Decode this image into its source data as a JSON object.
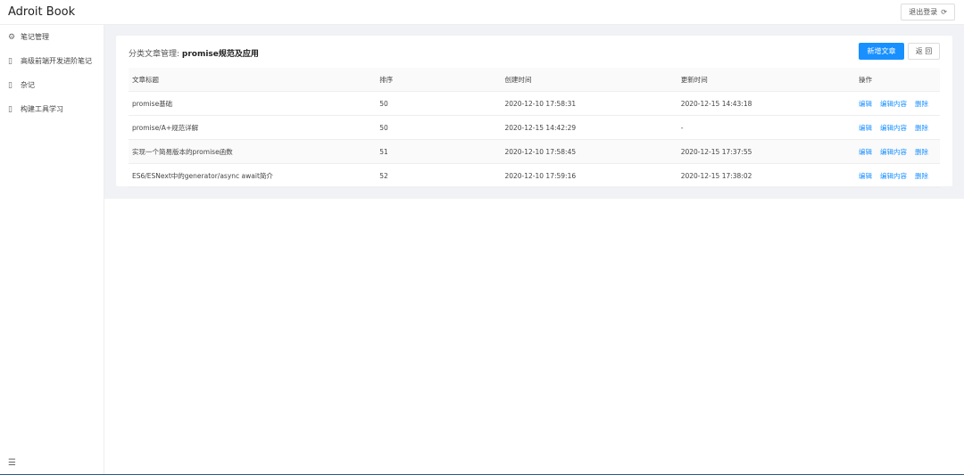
{
  "header": {
    "app_title": "Adroit Book",
    "logout_label": "退出登录",
    "logout_icon": "logout-icon"
  },
  "sidebar": {
    "items": [
      {
        "label": "笔记管理",
        "icon": "gear-icon"
      },
      {
        "label": "高级前端开发进阶笔记",
        "icon": "file-icon"
      },
      {
        "label": "杂记",
        "icon": "file-icon"
      },
      {
        "label": "构建工具学习",
        "icon": "file-icon"
      }
    ],
    "collapse_icon": "menu-fold-icon"
  },
  "main": {
    "title_prefix": "分类文章管理: ",
    "title_category": "promise规范及应用",
    "new_button": "新增文章",
    "back_button": "返 回",
    "table": {
      "headers": [
        "文章标题",
        "排序",
        "创建时间",
        "更新时间",
        "操作"
      ],
      "rows": [
        {
          "title": "promise基础",
          "order": "50",
          "created": "2020-12-10 17:58:31",
          "updated": "2020-12-15 14:43:18"
        },
        {
          "title": "promise/A+规范详解",
          "order": "50",
          "created": "2020-12-15 14:42:29",
          "updated": "-"
        },
        {
          "title": "实现一个简易版本的promise函数",
          "order": "51",
          "created": "2020-12-10 17:58:45",
          "updated": "2020-12-15 17:37:55"
        },
        {
          "title": "ES6/ESNext中的generator/async await简介",
          "order": "52",
          "created": "2020-12-10 17:59:16",
          "updated": "2020-12-15 17:38:02"
        }
      ],
      "actions": {
        "edit": "编辑",
        "edit_content": "编辑内容",
        "delete": "删除"
      }
    }
  },
  "colors": {
    "primary": "#1890ff",
    "bg": "#f0f2f5"
  }
}
